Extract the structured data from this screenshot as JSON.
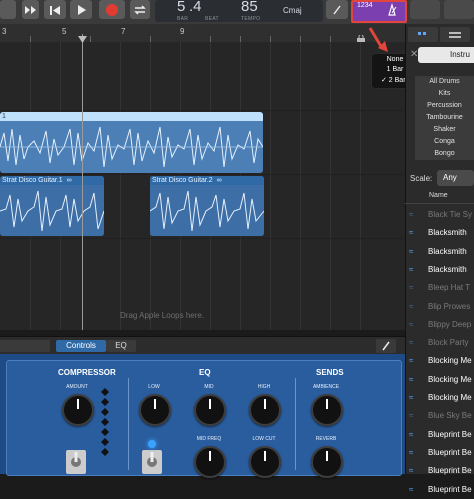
{
  "lcd": {
    "bar": "5",
    "beat": ".4",
    "bar_label": "BAR",
    "beat_label": "BEAT",
    "tempo": "85",
    "tempo_label": "TEMPO",
    "key": "Cmaj"
  },
  "count_in": {
    "label": "1234"
  },
  "ruler": {
    "marks": [
      "3",
      "5",
      "7",
      "9"
    ]
  },
  "regions": {
    "top_label": "1",
    "strat1": "Strat Disco Guitar.1",
    "strat2": "Strat Disco Guitar.2"
  },
  "loops_hint": "Drag Apple Loops here.",
  "popup": {
    "none": "None",
    "one_bar": "1 Bar",
    "two_bars": "2 Bars",
    "check": "✓"
  },
  "library": {
    "tab_label": "Instru",
    "categories": [
      "All Drums",
      "Kits",
      "Percussion",
      "Tambourine",
      "Shaker",
      "Conga",
      "Bongo"
    ],
    "scale_label": "Scale:",
    "scale_value": "Any",
    "name_header": "Name",
    "rows": [
      {
        "name": "Black Tie Sy",
        "active": false
      },
      {
        "name": "Blacksmith",
        "active": true
      },
      {
        "name": "Blacksmith",
        "active": true
      },
      {
        "name": "Blacksmith",
        "active": true
      },
      {
        "name": "Bleep Hat T",
        "active": false
      },
      {
        "name": "Blip Prowes",
        "active": false
      },
      {
        "name": "Blippy Deep",
        "active": false
      },
      {
        "name": "Block Party",
        "active": false
      },
      {
        "name": "Blocking Me",
        "active": true
      },
      {
        "name": "Blocking Me",
        "active": true
      },
      {
        "name": "Blocking Me",
        "active": true
      },
      {
        "name": "Blue Sky Be",
        "active": false
      },
      {
        "name": "Blueprint Be",
        "active": true
      },
      {
        "name": "Blueprint Be",
        "active": true
      },
      {
        "name": "Blueprint Be",
        "active": true
      },
      {
        "name": "Blueprint Be",
        "active": true
      }
    ]
  },
  "editor": {
    "tabs": [
      "Controls",
      "EQ"
    ],
    "sections": {
      "compressor": "COMPRESSOR",
      "eq": "EQ",
      "sends": "SENDS"
    },
    "knobs": {
      "amount": "AMOUNT",
      "low": "LOW",
      "mid": "MID",
      "high": "HIGH",
      "mid_freq": "MID FREQ",
      "low_cut": "LOW CUT",
      "ambience": "AMBIENCE",
      "reverb": "REVERB"
    }
  },
  "colors": {
    "accent_purple": "#7b3fb0",
    "region_blue": "#4c7fb5",
    "editor_blue": "#1e4b86",
    "popup_arrow": "#e2453b"
  }
}
